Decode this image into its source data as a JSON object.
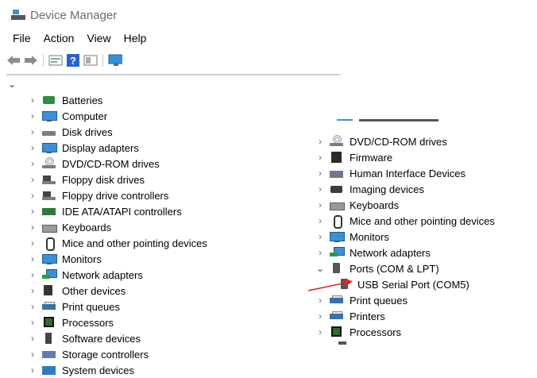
{
  "window": {
    "title": "Device Manager",
    "icon": "device-manager-icon"
  },
  "menu": {
    "items": [
      "File",
      "Action",
      "View",
      "Help"
    ]
  },
  "toolbar": {
    "buttons": [
      "back-icon",
      "forward-icon",
      "properties-icon",
      "help-icon",
      "view-icon",
      "monitor-icon"
    ]
  },
  "left_tree": {
    "items": [
      {
        "label": "Batteries",
        "icon": "battery-icon"
      },
      {
        "label": "Computer",
        "icon": "computer-icon"
      },
      {
        "label": "Disk drives",
        "icon": "disk-drive-icon"
      },
      {
        "label": "Display adapters",
        "icon": "display-adapter-icon"
      },
      {
        "label": "DVD/CD-ROM drives",
        "icon": "dvd-icon"
      },
      {
        "label": "Floppy disk drives",
        "icon": "floppy-icon"
      },
      {
        "label": "Floppy drive controllers",
        "icon": "floppy-controller-icon"
      },
      {
        "label": "IDE ATA/ATAPI controllers",
        "icon": "ide-icon"
      },
      {
        "label": "Keyboards",
        "icon": "keyboard-icon"
      },
      {
        "label": "Mice and other pointing devices",
        "icon": "mouse-icon"
      },
      {
        "label": "Monitors",
        "icon": "monitor-icon"
      },
      {
        "label": "Network adapters",
        "icon": "network-icon"
      },
      {
        "label": "Other devices",
        "icon": "other-devices-icon"
      },
      {
        "label": "Print queues",
        "icon": "print-queue-icon"
      },
      {
        "label": "Processors",
        "icon": "processor-icon"
      },
      {
        "label": "Software devices",
        "icon": "software-icon"
      },
      {
        "label": "Storage controllers",
        "icon": "storage-icon"
      },
      {
        "label": "System devices",
        "icon": "system-icon"
      }
    ]
  },
  "right_tree": {
    "items": [
      {
        "label": "DVD/CD-ROM drives",
        "icon": "dvd-icon",
        "expanded": false
      },
      {
        "label": "Firmware",
        "icon": "firmware-icon",
        "expanded": false
      },
      {
        "label": "Human Interface Devices",
        "icon": "hid-icon",
        "expanded": false
      },
      {
        "label": "Imaging devices",
        "icon": "camera-icon",
        "expanded": false
      },
      {
        "label": "Keyboards",
        "icon": "keyboard-icon",
        "expanded": false
      },
      {
        "label": "Mice and other pointing devices",
        "icon": "mouse-icon",
        "expanded": false
      },
      {
        "label": "Monitors",
        "icon": "monitor-icon",
        "expanded": false
      },
      {
        "label": "Network adapters",
        "icon": "network-icon",
        "expanded": false
      },
      {
        "label": "Ports (COM & LPT)",
        "icon": "port-icon",
        "expanded": true
      },
      {
        "label": "USB Serial Port (COM5)",
        "icon": "port-icon",
        "child": true
      },
      {
        "label": "Print queues",
        "icon": "print-queue-icon",
        "expanded": false
      },
      {
        "label": "Printers",
        "icon": "printer-icon",
        "expanded": false
      },
      {
        "label": "Processors",
        "icon": "processor-icon",
        "expanded": false
      }
    ]
  },
  "annotation": {
    "arrow_color": "#e02020"
  }
}
